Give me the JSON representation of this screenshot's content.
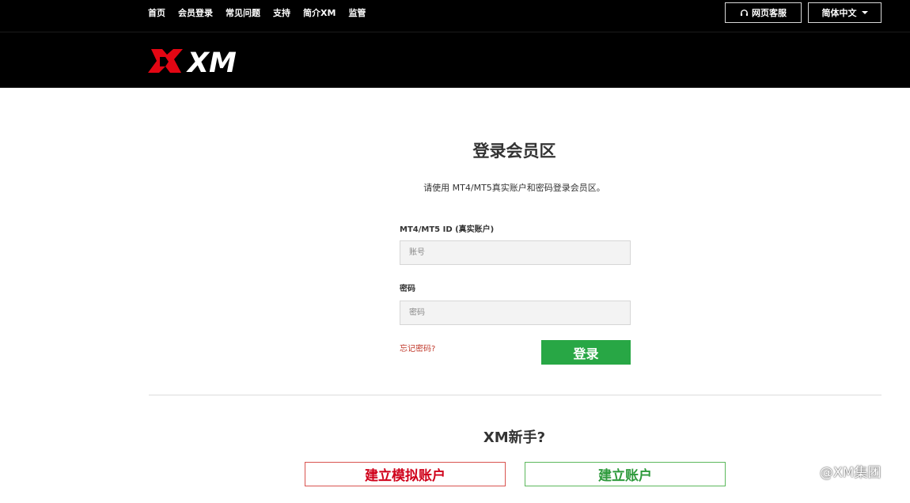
{
  "topnav": {
    "items": [
      "首页",
      "会员登录",
      "常见问题",
      "支持",
      "简介XM",
      "监管"
    ],
    "support_label": "网页客服",
    "support_icon": "headset-icon",
    "language_label": "简体中文"
  },
  "brand": {
    "logo_text": "XM",
    "logo_color": "#e30613"
  },
  "login": {
    "title": "登录会员区",
    "subtitle": "请使用 MT4/MT5真实账户和密码登录会员区。",
    "id_label": "MT4/MT5 ID (真实账户)",
    "id_placeholder": "账号",
    "password_label": "密码",
    "password_placeholder": "密码",
    "forgot_label": "忘记密码?",
    "submit_label": "登录"
  },
  "new_user": {
    "title": "XM新手?",
    "demo_label": "建立模拟账户",
    "real_label": "建立账户"
  },
  "watermark": {
    "text": "@XM集团"
  },
  "colors": {
    "accent_green": "#28a745",
    "accent_red": "#d0021b",
    "header_bg": "#000000"
  }
}
